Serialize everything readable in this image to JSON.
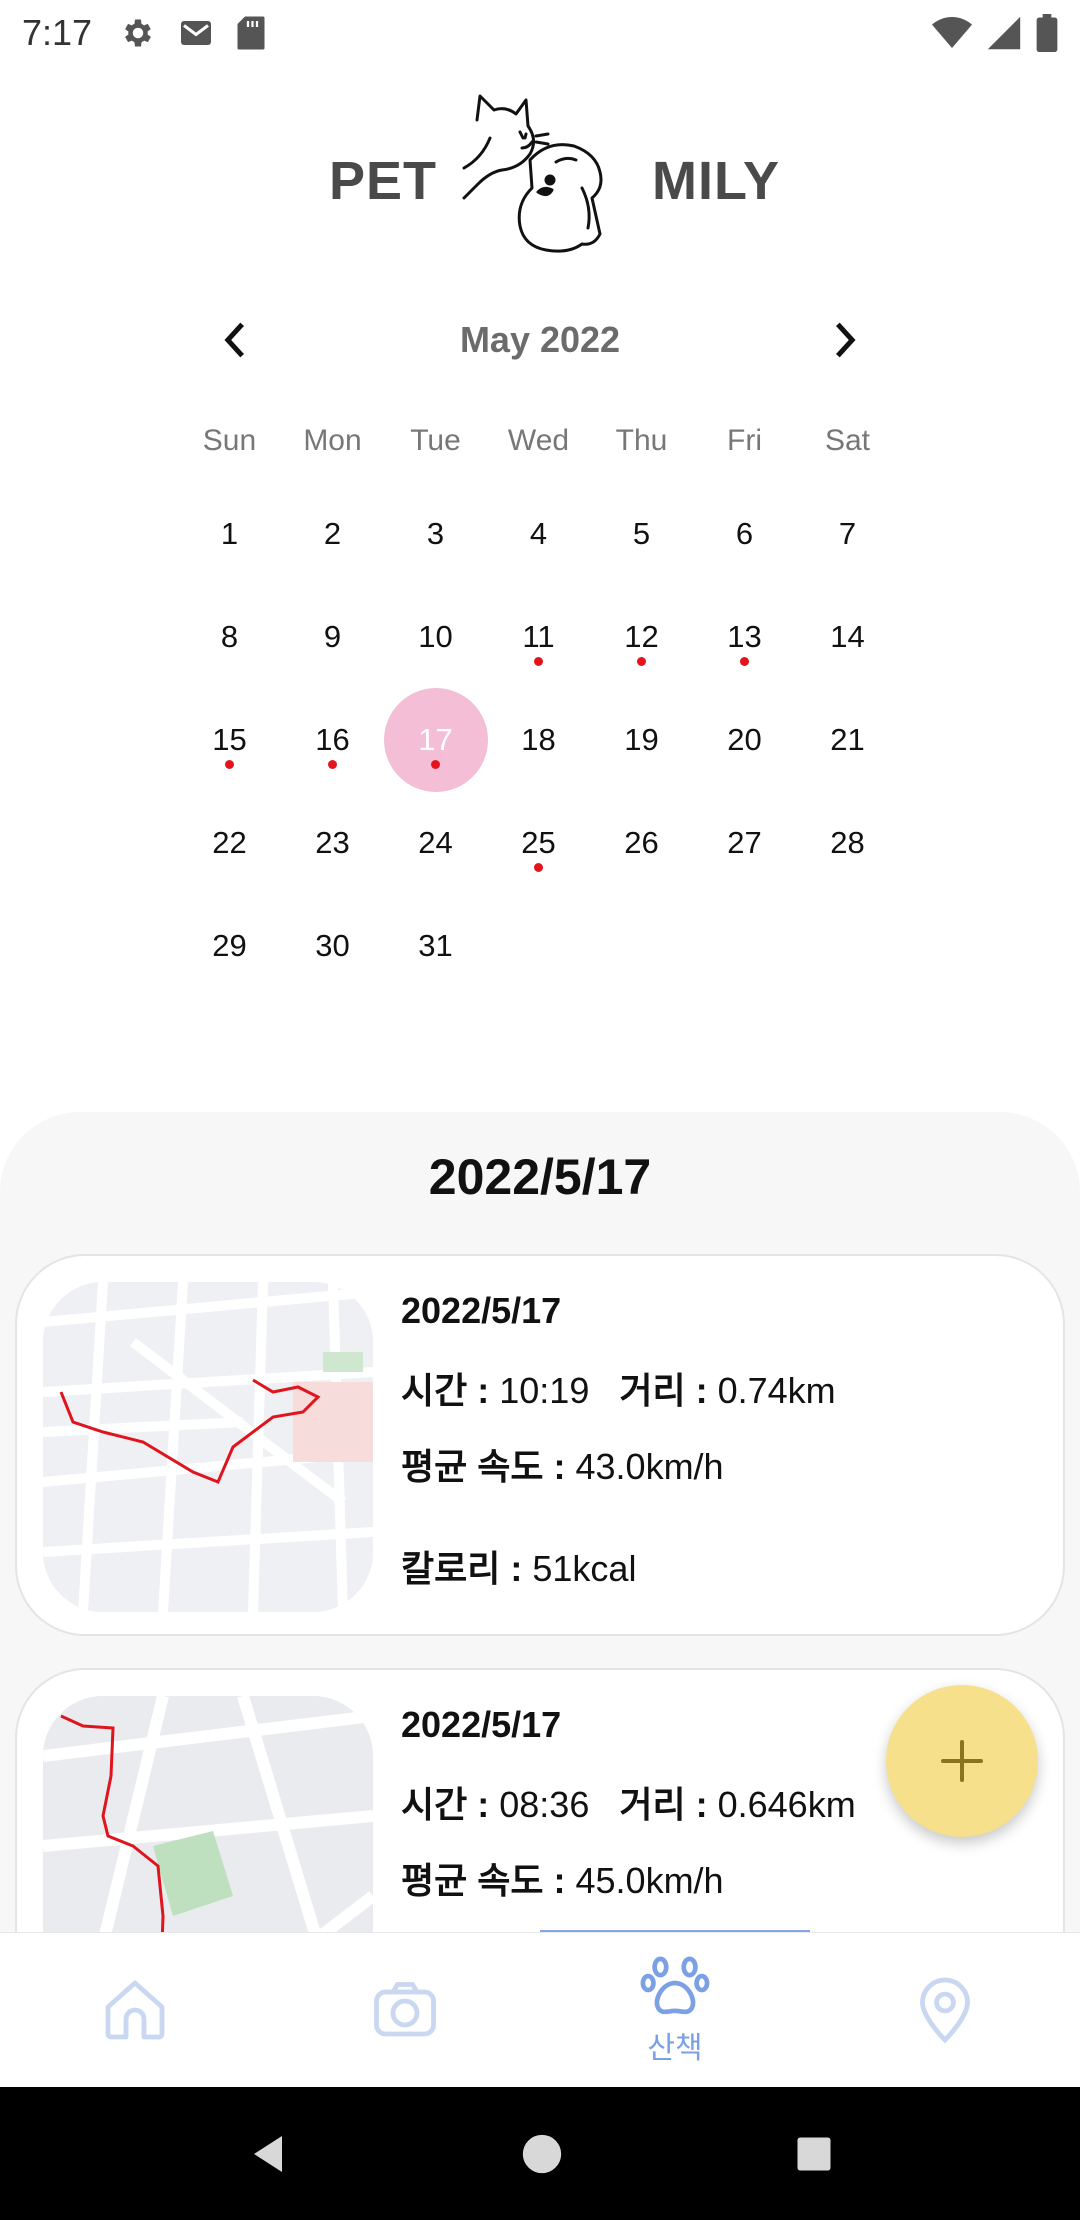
{
  "status_bar": {
    "time": "7:17",
    "left_icons": [
      "gear-icon",
      "mail-icon",
      "sd-card-icon"
    ],
    "right_icons": [
      "wifi-icon",
      "signal-icon",
      "battery-icon"
    ]
  },
  "logo": {
    "left_text": "PET",
    "right_text": "MILY"
  },
  "calendar": {
    "month_title": "May 2022",
    "weekdays": [
      "Sun",
      "Mon",
      "Tue",
      "Wed",
      "Thu",
      "Fri",
      "Sat"
    ],
    "start_offset": 0,
    "days_in_month": 31,
    "selected_day": 17,
    "dot_days": [
      11,
      12,
      13,
      15,
      16,
      17,
      25
    ],
    "selected_color": "#f4bed7",
    "dot_color": "#e4141c"
  },
  "sheet": {
    "title": "2022/5/17",
    "records": [
      {
        "date": "2022/5/17",
        "time_label": "시간 :",
        "time_value": "10:19",
        "distance_label": "거리 :",
        "distance_value": "0.74km",
        "speed_label": "평균 속도 :",
        "speed_value": "43.0km/h",
        "calorie_label": "칼로리 :",
        "calorie_value": "51kcal"
      },
      {
        "date": "2022/5/17",
        "time_label": "시간 :",
        "time_value": "08:36",
        "distance_label": "거리 :",
        "distance_value": "0.646km",
        "speed_label": "평균 속도 :",
        "speed_value": "45.0km/h"
      }
    ],
    "route_color": "#e0141c"
  },
  "fab": {
    "icon": "plus-icon",
    "color": "#f6e08c"
  },
  "bottom_nav": {
    "items": [
      {
        "icon": "home-icon"
      },
      {
        "icon": "camera-icon"
      },
      {
        "icon": "paw-icon",
        "label": "산책",
        "active": true
      },
      {
        "icon": "location-pin-icon"
      }
    ],
    "active_color": "#7ba0e4",
    "inactive_color": "#c9d7f1"
  },
  "system_nav": {
    "icons": [
      "back-icon",
      "home-circle-icon",
      "recents-icon"
    ]
  }
}
